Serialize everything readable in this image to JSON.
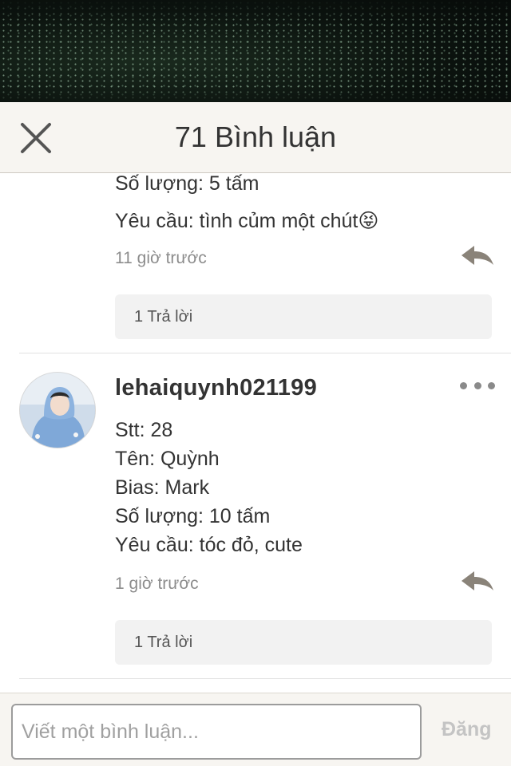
{
  "header": {
    "title": "71 Bình luận"
  },
  "comments": [
    {
      "lines": [
        "Số lượng: 5 tấm",
        "Yêu cầu: tình củm một chút😝"
      ],
      "time": "11 giờ trước",
      "replies_label": "1 Trả lời"
    },
    {
      "username": "lehaiquynh021199",
      "lines": [
        "Stt: 28",
        "Tên: Quỳnh",
        "Bias: Mark",
        "Số lượng: 10 tấm",
        "Yêu cầu: tóc đỏ, cute"
      ],
      "time": "1 giờ trước",
      "replies_label": "1 Trả lời"
    }
  ],
  "composer": {
    "placeholder": "Viết một bình luận...",
    "post_label": "Đăng"
  },
  "colors": {
    "header_bg": "#f7f5f1",
    "reply_icon": "#8a8379",
    "post_disabled": "#c4c4c4"
  }
}
